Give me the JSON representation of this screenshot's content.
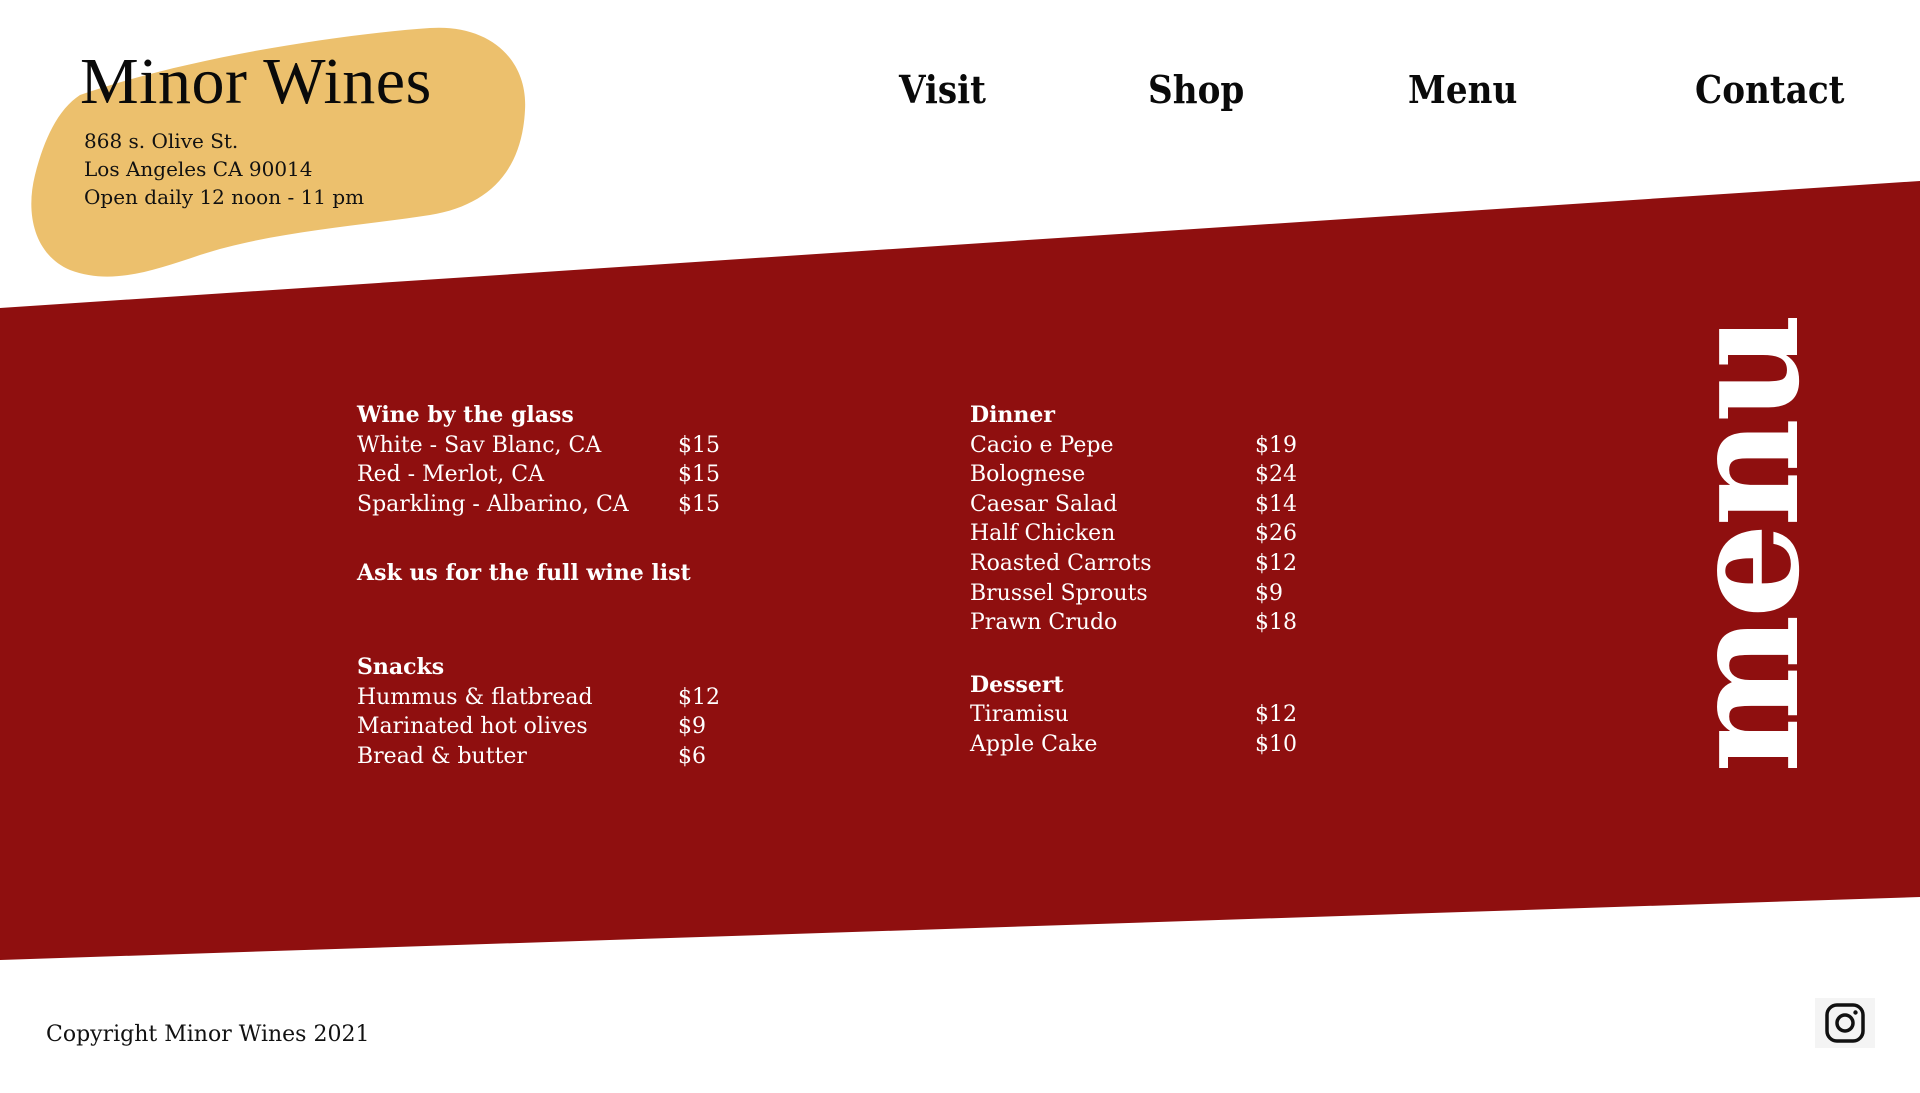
{
  "colors": {
    "band": "#8f0f0f",
    "blob": "#ecc06d",
    "text_dark": "#0a0a0a",
    "text_light": "#ffffff"
  },
  "brand": {
    "name": "Minor Wines",
    "address_lines": [
      "868 s. Olive St.",
      "Los Angeles CA 90014",
      "Open daily 12 noon - 11 pm"
    ]
  },
  "nav": {
    "items": [
      {
        "label": "Visit"
      },
      {
        "label": "Shop"
      },
      {
        "label": "Menu"
      },
      {
        "label": "Contact"
      }
    ]
  },
  "menu": {
    "vertical_title": "menu",
    "wine": {
      "heading": "Wine by the glass",
      "items": [
        {
          "name": "White - Sav Blanc, CA",
          "price": "$15"
        },
        {
          "name": "Red - Merlot, CA",
          "price": "$15"
        },
        {
          "name": "Sparkling - Albarino, CA",
          "price": "$15"
        }
      ],
      "note": "Ask us for the full wine list"
    },
    "snacks": {
      "heading": "Snacks",
      "items": [
        {
          "name": "Hummus & flatbread",
          "price": "$12"
        },
        {
          "name": "Marinated hot olives",
          "price": "$9"
        },
        {
          "name": "Bread & butter",
          "price": "$6"
        }
      ]
    },
    "dinner": {
      "heading": "Dinner",
      "items": [
        {
          "name": "Cacio e Pepe",
          "price": "$19"
        },
        {
          "name": "Bolognese",
          "price": "$24"
        },
        {
          "name": "Caesar Salad",
          "price": "$14"
        },
        {
          "name": "Half Chicken",
          "price": "$26"
        },
        {
          "name": "Roasted Carrots",
          "price": "$12"
        },
        {
          "name": "Brussel Sprouts",
          "price": "$9"
        },
        {
          "name": "Prawn Crudo",
          "price": "$18"
        }
      ]
    },
    "dessert": {
      "heading": "Dessert",
      "items": [
        {
          "name": "Tiramisu",
          "price": "$12"
        },
        {
          "name": "Apple Cake",
          "price": "$10"
        }
      ]
    }
  },
  "footer": {
    "copyright": "Copyright Minor Wines 2021",
    "social_icon": "instagram-icon"
  }
}
